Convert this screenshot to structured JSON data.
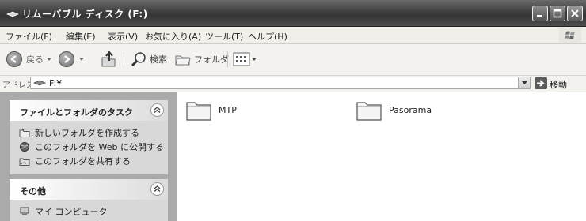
{
  "window": {
    "title": "リムーバブル ディスク (F:)"
  },
  "menu": {
    "items": [
      "ファイル(F)",
      "編集(E)",
      "表示(V)",
      "お気に入り(A)",
      "ツール(T)",
      "ヘルプ(H)"
    ]
  },
  "toolbar": {
    "back_label": "戻る",
    "search_label": "検索",
    "folders_label": "フォルダ"
  },
  "address": {
    "label": "アドレス(D)",
    "value": "F:¥",
    "go_label": "移動"
  },
  "left_pane": {
    "tasks_panel": {
      "title": "ファイルとフォルダのタスク",
      "items": [
        {
          "label": "新しいフォルダを作成する",
          "icon": "new-folder-icon"
        },
        {
          "label": "このフォルダを Web に公開する",
          "icon": "globe-icon"
        },
        {
          "label": "このフォルダを共有する",
          "icon": "share-folder-icon"
        }
      ]
    },
    "other_panel": {
      "title": "その他",
      "items": [
        {
          "label": "マイ コンピュータ",
          "icon": "my-computer-icon"
        }
      ]
    }
  },
  "content": {
    "folders": [
      {
        "name": "MTP",
        "icon": "folder-icon"
      },
      {
        "name": "Pasorama",
        "icon": "folder-icon"
      }
    ]
  }
}
